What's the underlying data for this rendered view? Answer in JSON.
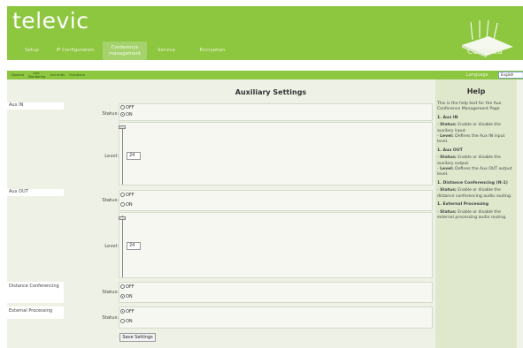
{
  "app": {
    "logo": "televic",
    "brand": "Confidea"
  },
  "nav": {
    "tabs": [
      {
        "label": "Setup"
      },
      {
        "label": "IP Configuration"
      },
      {
        "label": "Conference management",
        "active": true
      },
      {
        "label": "Service"
      },
      {
        "label": "Encryption"
      }
    ],
    "subtabs": [
      "General",
      "Unit Monitoring",
      "Ind Units",
      "Functions"
    ]
  },
  "language": {
    "label": "Language",
    "value": "English"
  },
  "page": {
    "title": "Auxiliary Settings"
  },
  "sections": [
    {
      "label": "Aux IN",
      "status_label": "Status:",
      "options": [
        "OFF",
        "ON"
      ],
      "selected": "ON",
      "level_label": "Level:",
      "level": "24"
    },
    {
      "label": "Aux OUT",
      "status_label": "Status:",
      "options": [
        "OFF",
        "ON"
      ],
      "selected": "none",
      "level_label": "Level:",
      "level": "24"
    },
    {
      "label": "Distance Conferencing",
      "status_label": "Status:",
      "options": [
        "OFF",
        "ON"
      ],
      "selected": "ON"
    },
    {
      "label": "External Processing",
      "status_label": "Status:",
      "options": [
        "OFF",
        "ON"
      ],
      "selected": "OFF"
    }
  ],
  "save_label": "Save Settings",
  "help": {
    "title": "Help",
    "intro": "This is the help text for the Aux Conference Management Page",
    "items": [
      {
        "heading": "1. Aux IN",
        "lines": [
          {
            "b": "Status:",
            "t": " Enable or disable the auxilary input."
          },
          {
            "b": "Level:",
            "t": " Defines the Aux IN input level."
          }
        ]
      },
      {
        "heading": "1. Aux OUT",
        "lines": [
          {
            "b": "Status:",
            "t": " Enable or disable the auxilary output."
          },
          {
            "b": "Level:",
            "t": " Defines the Aux OUT output level."
          }
        ]
      },
      {
        "heading": "1. Distance Conferencing (N-1)",
        "lines": [
          {
            "b": "Status:",
            "t": " Enable or disable the distance conferencing audio routing."
          }
        ]
      },
      {
        "heading": "1. External Processing",
        "lines": [
          {
            "b": "Status:",
            "t": " Enable or disable the external processing audio routing."
          }
        ]
      }
    ]
  },
  "colors": {
    "brand_green": "#8dc63f",
    "content_bg": "#eef2e6",
    "help_bg": "#dfe8cc"
  }
}
